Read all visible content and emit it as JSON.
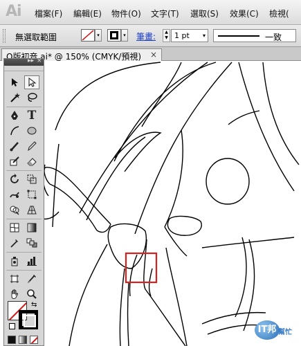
{
  "app": {
    "logo": "Ai"
  },
  "menu": {
    "items": [
      {
        "label": "檔案(F)"
      },
      {
        "label": "編輯(E)"
      },
      {
        "label": "物件(O)"
      },
      {
        "label": "文字(T)"
      },
      {
        "label": "選取(S)"
      },
      {
        "label": "效果(C)"
      },
      {
        "label": "檢視("
      }
    ]
  },
  "control": {
    "selection": "無選取範圍",
    "fill_arrow": "▾",
    "stroke_arrow": "▾",
    "stroke_label": "筆畫:",
    "weight_value": "1 pt",
    "weight_arrow": "▾",
    "profile_label": "一致"
  },
  "document": {
    "tab_title": "O版初音.ai* @ 150% (CMYK/預視)",
    "close": "×"
  },
  "tools": {
    "header_collapse": "▸▸",
    "header_close": "×",
    "type_tool_glyph": "T",
    "swap_glyph": "⇆"
  },
  "canvas": {
    "highlight_color": "#d8201e"
  },
  "watermark": {
    "badge": "IT邦",
    "text": "幫忙"
  },
  "colors": {
    "menubar": "#e6e6e6",
    "panel": "#d6d6d6",
    "link": "#1a3cc8",
    "fill_none_slash": "#d21414"
  }
}
